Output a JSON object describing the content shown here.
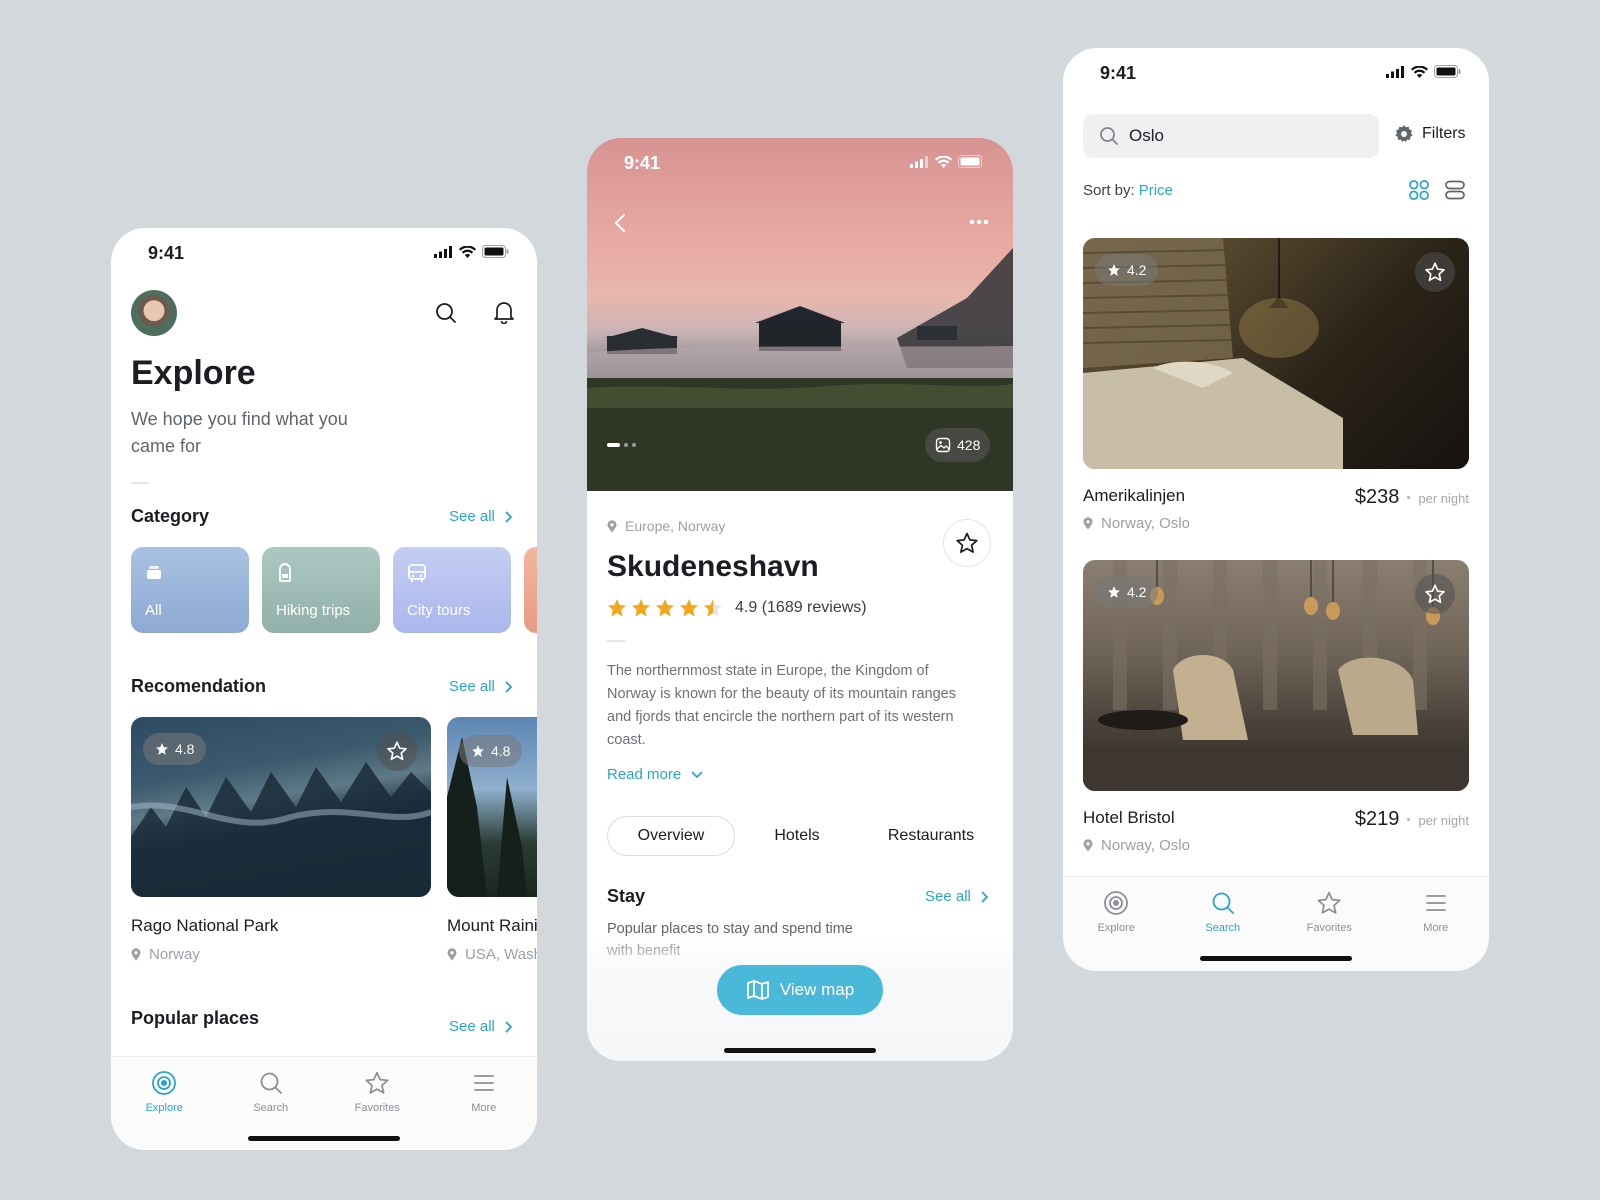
{
  "explore_screen": {
    "status_time": "9:41",
    "title": "Explore",
    "subtitle": "We hope you find what you came for",
    "category": {
      "title": "Category",
      "see_all": "See all",
      "items": [
        {
          "label": "All",
          "color": "#9ab4d6"
        },
        {
          "label": "Hiking trips",
          "color": "#9fbcb5"
        },
        {
          "label": "City tours",
          "color": "#b8c3ef"
        }
      ]
    },
    "recommendation": {
      "title": "Recomendation",
      "see_all": "See all",
      "items": [
        {
          "name": "Rago National Park",
          "location": "Norway",
          "rating": "4.8"
        },
        {
          "name": "Mount Raini",
          "location": "USA, Washi",
          "rating": "4.8"
        }
      ]
    },
    "popular": {
      "title": "Popular places",
      "see_all": "See all"
    },
    "tabs": [
      {
        "label": "Explore",
        "icon": "explore-icon",
        "active": true
      },
      {
        "label": "Search",
        "icon": "search-icon",
        "active": false
      },
      {
        "label": "Favorites",
        "icon": "star-icon",
        "active": false
      },
      {
        "label": "More",
        "icon": "menu-icon",
        "active": false
      }
    ]
  },
  "detail_screen": {
    "status_time": "9:41",
    "photo_count": "428",
    "location": "Europe, Norway",
    "title": "Skudeneshavn",
    "rating_text": "4.9 (1689 reviews)",
    "rating": 4.9,
    "description": "The northernmost state in Europe, the Kingdom of Norway is known for the beauty of its mountain ranges and fjords that encircle the northern part of its western coast.",
    "read_more": "Read more",
    "segments": [
      "Overview",
      "Hotels",
      "Restaurants"
    ],
    "active_segment": "Overview",
    "stay": {
      "title": "Stay",
      "see_all": "See all",
      "description": "Popular places to stay and spend time with benefit"
    },
    "view_map": "View map",
    "accent": "#4ab8d8"
  },
  "search_screen": {
    "status_time": "9:41",
    "search_value": "Oslo",
    "filters_label": "Filters",
    "sort_label": "Sort by:",
    "sort_value": "Price",
    "hotels": [
      {
        "name": "Amerikalinjen",
        "price": "$238",
        "per": "per night",
        "location": "Norway, Oslo",
        "rating": "4.2"
      },
      {
        "name": "Hotel Bristol",
        "price": "$219",
        "per": "per night",
        "location": "Norway, Oslo",
        "rating": "4.2"
      }
    ],
    "tabs": [
      {
        "label": "Explore",
        "icon": "explore-icon",
        "active": false
      },
      {
        "label": "Search",
        "icon": "search-icon",
        "active": true
      },
      {
        "label": "Favorites",
        "icon": "star-icon",
        "active": false
      },
      {
        "label": "More",
        "icon": "menu-icon",
        "active": false
      }
    ]
  }
}
